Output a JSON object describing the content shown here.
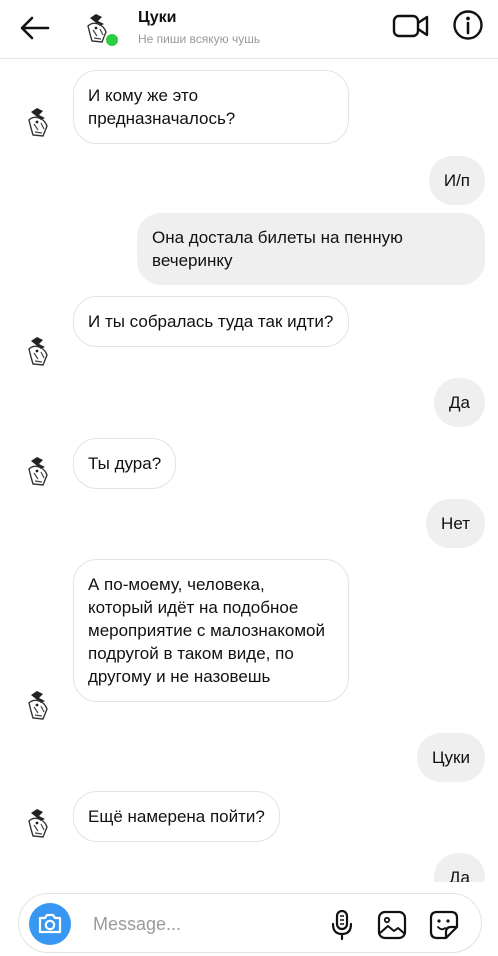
{
  "header": {
    "contact_name": "Цуки",
    "status": "Не пиши всякую чушь"
  },
  "messages": [
    {
      "side": "in",
      "text": "И кому же это предназначалось?",
      "avatar": true
    },
    {
      "side": "out",
      "text": "И/п"
    },
    {
      "side": "out",
      "text": "Она достала билеты на пенную вечеринку"
    },
    {
      "side": "in",
      "text": "И ты собралась туда так идти?",
      "avatar": true
    },
    {
      "side": "out",
      "text": "Да"
    },
    {
      "side": "in",
      "text": "Ты дура?",
      "avatar": true
    },
    {
      "side": "out",
      "text": "Нет"
    },
    {
      "side": "in",
      "text": "А по-моему, человека, который идёт на подобное мероприятие с малознакомой подругой в таком виде, по другому и не назовешь",
      "avatar": true
    },
    {
      "side": "out",
      "text": "Цуки"
    },
    {
      "side": "in",
      "text": "Ещё намерена пойти?",
      "avatar": true
    },
    {
      "side": "out",
      "text": "Да"
    }
  ],
  "composer": {
    "placeholder": "Message..."
  },
  "colors": {
    "accent": "#3897f0",
    "online": "#2ecc40",
    "incoming_bg": "#ffffff",
    "outgoing_bg": "#efefef"
  },
  "icons": [
    "back-arrow-icon",
    "video-camera-icon",
    "info-icon",
    "camera-icon",
    "microphone-icon",
    "gallery-icon",
    "sticker-icon"
  ]
}
